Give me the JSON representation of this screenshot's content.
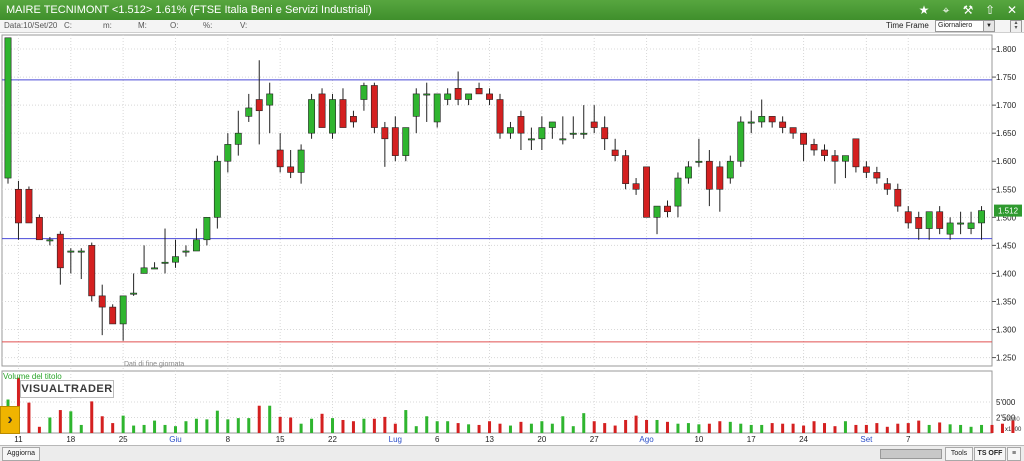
{
  "window": {
    "title": "MAIRE TECNIMONT <1.512> 1.61%  (FTSE Italia Beni e Servizi Industriali)",
    "icons": [
      "star-icon",
      "pin-icon",
      "hammer-icon",
      "arrow-up-icon",
      "close-icon"
    ]
  },
  "infobar": {
    "date": "Data:10/Set/20",
    "c": "C:",
    "m": "m:",
    "mm": "M:",
    "o": "O:",
    "pct": "%:",
    "v": "V:",
    "time_frame_label": "Time Frame",
    "time_frame_value": "Giornaliero"
  },
  "chart": {
    "watermark": "VISUALTRADER",
    "eod_note": "Dati di fine giornata",
    "volume_label": "Volume del titolo",
    "price_ticks": [
      "1.800",
      "1.750",
      "1.700",
      "1.650",
      "1.600",
      "1.550",
      "1.500",
      "1.450",
      "1.400",
      "1.350",
      "1.300",
      "1.250"
    ],
    "last_price": "1.512",
    "volume_ticks": [
      "5'000",
      "2'500",
      "x1000"
    ],
    "volume_max_display": "10000",
    "date_ticks": [
      {
        "label": "11",
        "i": 1,
        "month": false
      },
      {
        "label": "18",
        "i": 6,
        "month": false
      },
      {
        "label": "25",
        "i": 11,
        "month": false
      },
      {
        "label": "Giu",
        "i": 16,
        "month": true
      },
      {
        "label": "8",
        "i": 21,
        "month": false
      },
      {
        "label": "15",
        "i": 26,
        "month": false
      },
      {
        "label": "22",
        "i": 31,
        "month": false
      },
      {
        "label": "Lug",
        "i": 37,
        "month": true
      },
      {
        "label": "6",
        "i": 41,
        "month": false
      },
      {
        "label": "13",
        "i": 46,
        "month": false
      },
      {
        "label": "20",
        "i": 51,
        "month": false
      },
      {
        "label": "27",
        "i": 56,
        "month": false
      },
      {
        "label": "Ago",
        "i": 61,
        "month": true
      },
      {
        "label": "10",
        "i": 66,
        "month": false
      },
      {
        "label": "17",
        "i": 71,
        "month": false
      },
      {
        "label": "24",
        "i": 76,
        "month": false
      },
      {
        "label": "Set",
        "i": 82,
        "month": true
      },
      {
        "label": "7",
        "i": 86,
        "month": false
      }
    ],
    "hlines": [
      {
        "price": 1.745,
        "color": "#4a4ad8"
      },
      {
        "price": 1.462,
        "color": "#4a4ad8"
      },
      {
        "price": 1.278,
        "color": "#e05050"
      }
    ],
    "colors": {
      "up": "#2fb52f",
      "down": "#d42020",
      "grid": "#d8d8d8"
    }
  },
  "chart_data": {
    "type": "candlestick",
    "series": [
      {
        "o": 1.57,
        "h": 1.82,
        "l": 1.56,
        "c": 1.82
      },
      {
        "o": 1.55,
        "h": 1.565,
        "l": 1.46,
        "c": 1.49
      },
      {
        "o": 1.55,
        "h": 1.555,
        "l": 1.49,
        "c": 1.49
      },
      {
        "o": 1.5,
        "h": 1.505,
        "l": 1.46,
        "c": 1.46
      },
      {
        "o": 1.46,
        "h": 1.465,
        "l": 1.45,
        "c": 1.46
      },
      {
        "o": 1.47,
        "h": 1.475,
        "l": 1.38,
        "c": 1.41
      },
      {
        "o": 1.44,
        "h": 1.445,
        "l": 1.4,
        "c": 1.44
      },
      {
        "o": 1.44,
        "h": 1.445,
        "l": 1.39,
        "c": 1.44
      },
      {
        "o": 1.45,
        "h": 1.455,
        "l": 1.35,
        "c": 1.36
      },
      {
        "o": 1.36,
        "h": 1.38,
        "l": 1.29,
        "c": 1.34
      },
      {
        "o": 1.34,
        "h": 1.345,
        "l": 1.31,
        "c": 1.31
      },
      {
        "o": 1.31,
        "h": 1.36,
        "l": 1.28,
        "c": 1.36
      },
      {
        "o": 1.365,
        "h": 1.4,
        "l": 1.36,
        "c": 1.365
      },
      {
        "o": 1.4,
        "h": 1.45,
        "l": 1.4,
        "c": 1.41
      },
      {
        "o": 1.41,
        "h": 1.42,
        "l": 1.41,
        "c": 1.41
      },
      {
        "o": 1.42,
        "h": 1.48,
        "l": 1.4,
        "c": 1.42
      },
      {
        "o": 1.42,
        "h": 1.46,
        "l": 1.41,
        "c": 1.43
      },
      {
        "o": 1.44,
        "h": 1.45,
        "l": 1.43,
        "c": 1.44
      },
      {
        "o": 1.44,
        "h": 1.48,
        "l": 1.44,
        "c": 1.46
      },
      {
        "o": 1.46,
        "h": 1.5,
        "l": 1.45,
        "c": 1.5
      },
      {
        "o": 1.5,
        "h": 1.61,
        "l": 1.48,
        "c": 1.6
      },
      {
        "o": 1.6,
        "h": 1.65,
        "l": 1.58,
        "c": 1.63
      },
      {
        "o": 1.63,
        "h": 1.69,
        "l": 1.61,
        "c": 1.65
      },
      {
        "o": 1.68,
        "h": 1.72,
        "l": 1.67,
        "c": 1.695
      },
      {
        "o": 1.71,
        "h": 1.78,
        "l": 1.63,
        "c": 1.69
      },
      {
        "o": 1.7,
        "h": 1.74,
        "l": 1.65,
        "c": 1.72
      },
      {
        "o": 1.62,
        "h": 1.65,
        "l": 1.58,
        "c": 1.59
      },
      {
        "o": 1.59,
        "h": 1.62,
        "l": 1.57,
        "c": 1.58
      },
      {
        "o": 1.58,
        "h": 1.63,
        "l": 1.56,
        "c": 1.62
      },
      {
        "o": 1.65,
        "h": 1.72,
        "l": 1.64,
        "c": 1.71
      },
      {
        "o": 1.72,
        "h": 1.73,
        "l": 1.66,
        "c": 1.66
      },
      {
        "o": 1.65,
        "h": 1.72,
        "l": 1.64,
        "c": 1.71
      },
      {
        "o": 1.71,
        "h": 1.73,
        "l": 1.66,
        "c": 1.66
      },
      {
        "o": 1.68,
        "h": 1.69,
        "l": 1.66,
        "c": 1.67
      },
      {
        "o": 1.71,
        "h": 1.74,
        "l": 1.69,
        "c": 1.735
      },
      {
        "o": 1.735,
        "h": 1.74,
        "l": 1.65,
        "c": 1.66
      },
      {
        "o": 1.66,
        "h": 1.67,
        "l": 1.59,
        "c": 1.64
      },
      {
        "o": 1.66,
        "h": 1.68,
        "l": 1.6,
        "c": 1.61
      },
      {
        "o": 1.61,
        "h": 1.66,
        "l": 1.6,
        "c": 1.66
      },
      {
        "o": 1.68,
        "h": 1.73,
        "l": 1.65,
        "c": 1.72
      },
      {
        "o": 1.72,
        "h": 1.74,
        "l": 1.67,
        "c": 1.72
      },
      {
        "o": 1.67,
        "h": 1.72,
        "l": 1.66,
        "c": 1.72
      },
      {
        "o": 1.71,
        "h": 1.73,
        "l": 1.7,
        "c": 1.72
      },
      {
        "o": 1.73,
        "h": 1.76,
        "l": 1.7,
        "c": 1.71
      },
      {
        "o": 1.71,
        "h": 1.72,
        "l": 1.7,
        "c": 1.72
      },
      {
        "o": 1.73,
        "h": 1.74,
        "l": 1.72,
        "c": 1.72
      },
      {
        "o": 1.72,
        "h": 1.73,
        "l": 1.7,
        "c": 1.71
      },
      {
        "o": 1.71,
        "h": 1.72,
        "l": 1.64,
        "c": 1.65
      },
      {
        "o": 1.65,
        "h": 1.67,
        "l": 1.64,
        "c": 1.66
      },
      {
        "o": 1.68,
        "h": 1.69,
        "l": 1.62,
        "c": 1.65
      },
      {
        "o": 1.64,
        "h": 1.66,
        "l": 1.62,
        "c": 1.64
      },
      {
        "o": 1.64,
        "h": 1.68,
        "l": 1.62,
        "c": 1.66
      },
      {
        "o": 1.66,
        "h": 1.67,
        "l": 1.64,
        "c": 1.67
      },
      {
        "o": 1.64,
        "h": 1.68,
        "l": 1.63,
        "c": 1.64
      },
      {
        "o": 1.65,
        "h": 1.68,
        "l": 1.64,
        "c": 1.65
      },
      {
        "o": 1.65,
        "h": 1.7,
        "l": 1.64,
        "c": 1.65
      },
      {
        "o": 1.67,
        "h": 1.7,
        "l": 1.65,
        "c": 1.66
      },
      {
        "o": 1.66,
        "h": 1.68,
        "l": 1.62,
        "c": 1.64
      },
      {
        "o": 1.62,
        "h": 1.64,
        "l": 1.6,
        "c": 1.61
      },
      {
        "o": 1.61,
        "h": 1.62,
        "l": 1.55,
        "c": 1.56
      },
      {
        "o": 1.56,
        "h": 1.57,
        "l": 1.54,
        "c": 1.55
      },
      {
        "o": 1.59,
        "h": 1.59,
        "l": 1.5,
        "c": 1.5
      },
      {
        "o": 1.5,
        "h": 1.52,
        "l": 1.47,
        "c": 1.52
      },
      {
        "o": 1.52,
        "h": 1.53,
        "l": 1.5,
        "c": 1.51
      },
      {
        "o": 1.52,
        "h": 1.58,
        "l": 1.5,
        "c": 1.57
      },
      {
        "o": 1.57,
        "h": 1.6,
        "l": 1.56,
        "c": 1.59
      },
      {
        "o": 1.6,
        "h": 1.64,
        "l": 1.59,
        "c": 1.6
      },
      {
        "o": 1.6,
        "h": 1.62,
        "l": 1.52,
        "c": 1.55
      },
      {
        "o": 1.59,
        "h": 1.6,
        "l": 1.51,
        "c": 1.55
      },
      {
        "o": 1.57,
        "h": 1.61,
        "l": 1.56,
        "c": 1.6
      },
      {
        "o": 1.6,
        "h": 1.68,
        "l": 1.59,
        "c": 1.67
      },
      {
        "o": 1.67,
        "h": 1.69,
        "l": 1.65,
        "c": 1.67
      },
      {
        "o": 1.67,
        "h": 1.71,
        "l": 1.66,
        "c": 1.68
      },
      {
        "o": 1.68,
        "h": 1.68,
        "l": 1.66,
        "c": 1.67
      },
      {
        "o": 1.67,
        "h": 1.68,
        "l": 1.65,
        "c": 1.66
      },
      {
        "o": 1.66,
        "h": 1.66,
        "l": 1.64,
        "c": 1.65
      },
      {
        "o": 1.65,
        "h": 1.65,
        "l": 1.6,
        "c": 1.63
      },
      {
        "o": 1.63,
        "h": 1.64,
        "l": 1.61,
        "c": 1.62
      },
      {
        "o": 1.62,
        "h": 1.63,
        "l": 1.6,
        "c": 1.61
      },
      {
        "o": 1.61,
        "h": 1.62,
        "l": 1.56,
        "c": 1.6
      },
      {
        "o": 1.6,
        "h": 1.61,
        "l": 1.57,
        "c": 1.61
      },
      {
        "o": 1.64,
        "h": 1.64,
        "l": 1.58,
        "c": 1.59
      },
      {
        "o": 1.59,
        "h": 1.6,
        "l": 1.57,
        "c": 1.58
      },
      {
        "o": 1.58,
        "h": 1.59,
        "l": 1.56,
        "c": 1.57
      },
      {
        "o": 1.56,
        "h": 1.57,
        "l": 1.54,
        "c": 1.55
      },
      {
        "o": 1.55,
        "h": 1.56,
        "l": 1.51,
        "c": 1.52
      },
      {
        "o": 1.51,
        "h": 1.52,
        "l": 1.48,
        "c": 1.49
      },
      {
        "o": 1.5,
        "h": 1.51,
        "l": 1.46,
        "c": 1.48
      },
      {
        "o": 1.48,
        "h": 1.51,
        "l": 1.46,
        "c": 1.51
      },
      {
        "o": 1.51,
        "h": 1.52,
        "l": 1.47,
        "c": 1.48
      },
      {
        "o": 1.47,
        "h": 1.5,
        "l": 1.46,
        "c": 1.49
      },
      {
        "o": 1.49,
        "h": 1.51,
        "l": 1.47,
        "c": 1.49
      },
      {
        "o": 1.48,
        "h": 1.51,
        "l": 1.47,
        "c": 1.49
      },
      {
        "o": 1.49,
        "h": 1.52,
        "l": 1.46,
        "c": 1.512
      }
    ],
    "volume": [
      5400,
      8900,
      4900,
      1000,
      2500,
      3700,
      3500,
      1300,
      5100,
      2700,
      1600,
      2800,
      1200,
      1300,
      2000,
      1300,
      1100,
      1900,
      2300,
      2200,
      3600,
      2200,
      2400,
      2400,
      4400,
      4400,
      2600,
      2500,
      1500,
      2300,
      3100,
      2400,
      2100,
      1900,
      2300,
      2300,
      2600,
      1500,
      3700,
      1100,
      2700,
      1900,
      1900,
      1600,
      1400,
      1300,
      1900,
      1500,
      1200,
      1800,
      1500,
      1900,
      1500,
      2700,
      1100,
      3200,
      1900,
      1600,
      1200,
      2100,
      2800,
      2100,
      2100,
      1800,
      1500,
      1600,
      1400,
      1500,
      1900,
      1800,
      1500,
      1300,
      1300,
      1600,
      1500,
      1500,
      1200,
      1900,
      1600,
      1100,
      1900,
      1300,
      1300,
      1600,
      1000,
      1500,
      1600,
      2000,
      1300,
      1700,
      1400,
      1300,
      1000,
      1300,
      1300,
      1500,
      2000
    ],
    "ylim": [
      1.235,
      1.825
    ]
  },
  "bottombar": {
    "aggiorna": "Aggiorna",
    "tools": "Tools",
    "tsoff": "TS OFF"
  }
}
